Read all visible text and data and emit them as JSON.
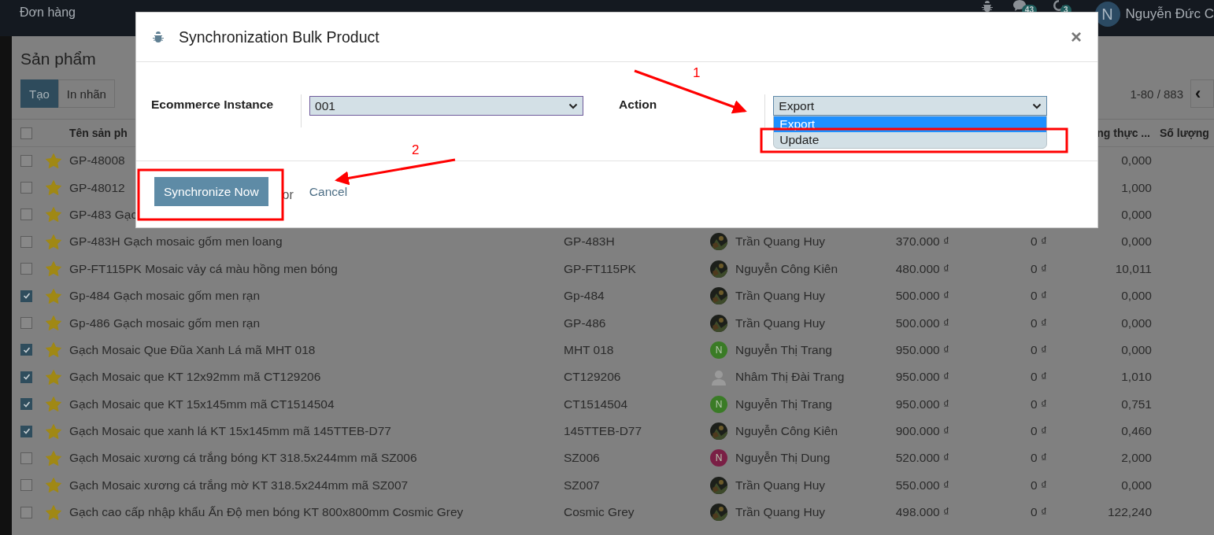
{
  "navbar": {
    "menu": [
      "Đơn hàng"
    ],
    "chat_count": "43",
    "activity_count": "3",
    "user": {
      "initial": "N",
      "name": "Nguyễn Đức C"
    }
  },
  "page": {
    "title": "Sản phẩm",
    "buttons": [
      {
        "label": "Tạo",
        "kind": "primary"
      },
      {
        "label": "In nhãn",
        "kind": "secondary"
      }
    ],
    "pager": "1-80 / 883",
    "pager_prev": "‹"
  },
  "table": {
    "select_all": false,
    "columns": [
      "Tên sản ph",
      "ng thực ...",
      "Số lượng"
    ],
    "rows": [
      {
        "selected": false,
        "starred": true,
        "name": "GP-48008",
        "quantity": "0,000"
      },
      {
        "selected": false,
        "starred": true,
        "name": "GP-48012",
        "quantity": "1,000"
      },
      {
        "selected": false,
        "starred": true,
        "name": "GP-483 Gạc",
        "quantity": "0,000"
      },
      {
        "selected": false,
        "starred": true,
        "name": "GP-483H Gạch mosaic gốm men loang",
        "reference": "GP-483H",
        "responsible": {
          "name": "Trần Quang Huy"
        },
        "price": "370.000 ₫",
        "cost": "0 ₫",
        "quantity": "0,000"
      },
      {
        "selected": false,
        "starred": true,
        "name": "GP-FT115PK Mosaic vảy cá màu hồng men bóng",
        "reference": "GP-FT115PK",
        "responsible": {
          "name": "Nguyễn Công Kiên"
        },
        "price": "480.000 ₫",
        "cost": "0 ₫",
        "quantity": "10,011"
      },
      {
        "selected": true,
        "starred": true,
        "name": "Gp-484 Gạch mosaic gốm men rạn",
        "reference": "Gp-484",
        "responsible": {
          "name": "Trần Quang Huy"
        },
        "price": "500.000 ₫",
        "cost": "0 ₫",
        "quantity": "0,000"
      },
      {
        "selected": false,
        "starred": true,
        "name": "Gp-486 Gạch mosaic gốm men rạn",
        "reference": "GP-486",
        "responsible": {
          "name": "Trần Quang Huy"
        },
        "price": "500.000 ₫",
        "cost": "0 ₫",
        "quantity": "0,000"
      },
      {
        "selected": true,
        "starred": true,
        "name": "Gạch Mosaic Que Đũa Xanh Lá mã MHT 018",
        "reference": "MHT 018",
        "responsible": {
          "kind": "letter",
          "initial": "N",
          "color": "#3a7b26",
          "name": "Nguyễn Thị Trang"
        },
        "price": "950.000 ₫",
        "cost": "0 ₫",
        "quantity": "0,000"
      },
      {
        "selected": true,
        "starred": true,
        "name": "Gạch Mosaic que KT 12x92mm mã CT129206",
        "reference": "CT129206",
        "responsible": {
          "kind": "placeholder",
          "name": "Nhâm Thị Đài Trang"
        },
        "price": "950.000 ₫",
        "cost": "0 ₫",
        "quantity": "1,010"
      },
      {
        "selected": true,
        "starred": true,
        "name": "Gạch Mosaic que KT 15x145mm mã CT1514504",
        "reference": "CT1514504",
        "responsible": {
          "kind": "letter",
          "initial": "N",
          "color": "#3a7b26",
          "name": "Nguyễn Thị Trang"
        },
        "price": "950.000 ₫",
        "cost": "0 ₫",
        "quantity": "0,751"
      },
      {
        "selected": true,
        "starred": true,
        "name": "Gạch Mosaic que xanh lá KT 15x145mm mã 145TTEB-D77",
        "reference": "145TTEB-D77",
        "responsible": {
          "name": "Nguyễn Công Kiên"
        },
        "price": "900.000 ₫",
        "cost": "0 ₫",
        "quantity": "0,460"
      },
      {
        "selected": false,
        "starred": true,
        "name": "Gạch Mosaic xương cá trắng bóng KT 318.5x244mm mã SZ006",
        "reference": "SZ006",
        "responsible": {
          "kind": "letter",
          "initial": "N",
          "color": "#7a1f45",
          "name": "Nguyễn Thị Dung"
        },
        "price": "520.000 ₫",
        "cost": "0 ₫",
        "quantity": "2,000"
      },
      {
        "selected": false,
        "starred": true,
        "name": "Gạch Mosaic xương cá trắng mờ KT 318.5x244mm mã SZ007",
        "reference": "SZ007",
        "responsible": {
          "name": "Trần Quang Huy"
        },
        "price": "550.000 ₫",
        "cost": "0 ₫",
        "quantity": "0,000"
      },
      {
        "selected": false,
        "starred": true,
        "name": "Gạch cao cấp nhập khẩu Ấn Độ men bóng KT 800x800mm Cosmic Grey",
        "reference": "Cosmic Grey",
        "responsible": {
          "name": "Trần Quang Huy"
        },
        "price": "498.000 ₫",
        "cost": "0 ₫",
        "quantity": "122,240"
      }
    ]
  },
  "modal": {
    "title": "Synchronization Bulk Product",
    "close": "×",
    "fields": [
      {
        "label": "Ecommerce Instance",
        "value": "001",
        "open": false
      },
      {
        "label": "Action",
        "value": "Export",
        "open": true,
        "options": [
          {
            "label": "Export",
            "selected": true
          },
          {
            "label": "Update",
            "selected": false
          }
        ]
      }
    ],
    "primary_button": "Synchronize Now",
    "separator": "or",
    "cancel": "Cancel"
  },
  "annotations": {
    "labels": [
      "1",
      "2"
    ]
  }
}
